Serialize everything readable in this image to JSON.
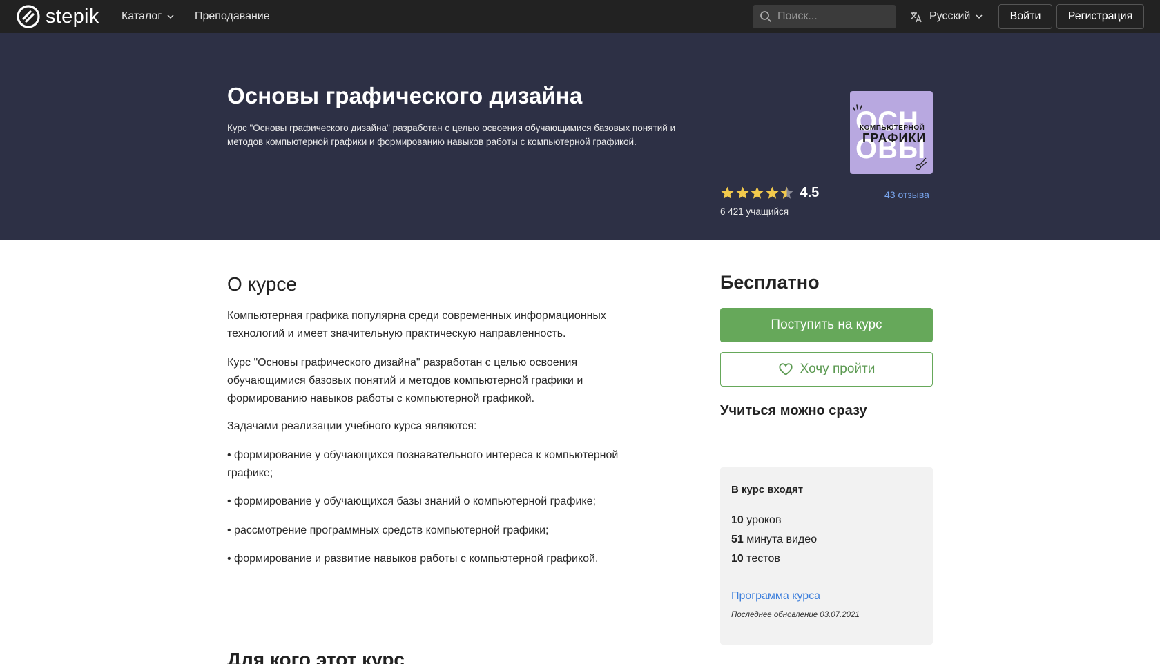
{
  "nav": {
    "logo_text": "stepik",
    "catalog": "Каталог",
    "teaching": "Преподавание",
    "search_placeholder": "Поиск...",
    "language": "Русский",
    "login": "Войти",
    "register": "Регистрация"
  },
  "hero": {
    "title": "Основы графического дизайна",
    "summary": "Курс \"Основы графического дизайна\" разработан с целью освоения обучающимися базовых понятий и методов компьютерной графики и формированию навыков работы с компьютерной графикой.",
    "cover": {
      "line_top": "ОСН",
      "line_small": "КОМПЬЮТЕРНОЙ",
      "line_mid": "ГРАФИКИ",
      "line_bot": "ОВЫ"
    },
    "rating": "4.5",
    "rating_stars": 4.5,
    "reviews": "43 отзыва",
    "learners": "6 421 учащийся"
  },
  "about": {
    "heading": "О курсе",
    "paragraphs": [
      "Компьютерная графика популярна среди современных информационных технологий и имеет значительную практическую направленность.",
      "Курс \"Основы графического дизайна\" разработан с целью освоения обучающимися базовых понятий и методов компьютерной графики и формированию навыков работы с компьютерной графикой.",
      "Задачами реализации учебного курса являются:",
      "• формирование у обучающихся познавательного интереса к компьютерной графике;",
      "• формирование у обучающихся базы знаний о компьютерной графике;",
      "• рассмотрение программных средств компьютерной графики;",
      "• формирование и развитие навыков работы с компьютерной графикой."
    ],
    "next_heading": "Для кого этот курс"
  },
  "sidebar": {
    "price": "Бесплатно",
    "enroll": "Поступить на курс",
    "wishlist": "Хочу пройти",
    "learn_now": "Учиться можно сразу",
    "includes_title": "В курс входят",
    "includes": [
      {
        "count": "10",
        "label": "уроков"
      },
      {
        "count": "51",
        "label": "минута видео"
      },
      {
        "count": "10",
        "label": "тестов"
      }
    ],
    "program_link": "Программа курса",
    "updated": "Последнее обновление 03.07.2021"
  },
  "colors": {
    "nav_bg": "#222222",
    "hero_bg": "#2d3045",
    "accent_green": "#66a85a",
    "link_blue": "#3d7fdc",
    "star_gold": "#f2c94c"
  }
}
